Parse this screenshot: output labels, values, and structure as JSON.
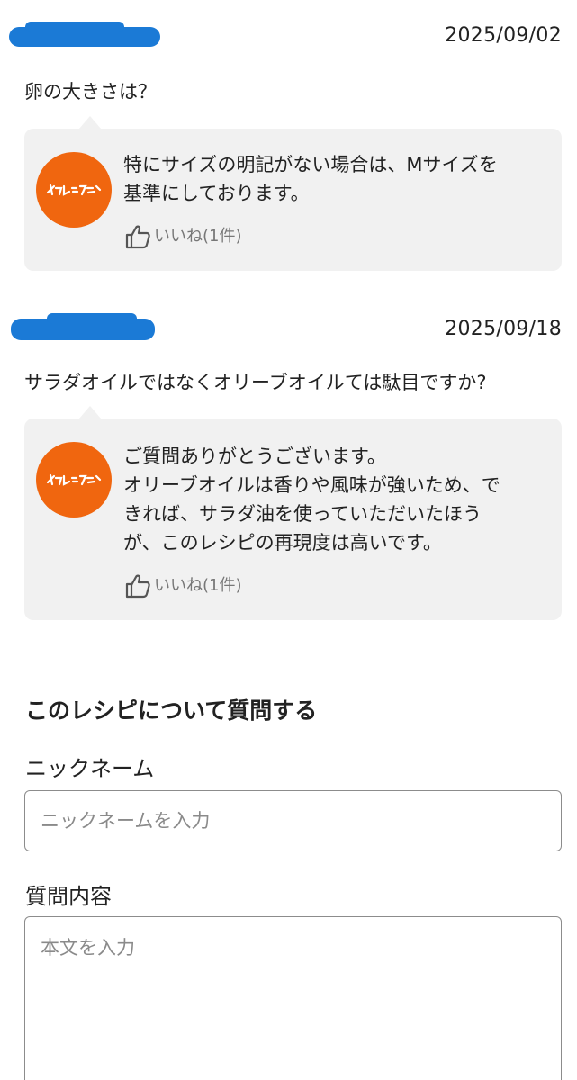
{
  "qa": [
    {
      "date": "2025/09/02",
      "question": "卵の大きさは？",
      "answer": "特にサイズの明記がない場合は、Mサイズを\n基準にしております。",
      "like_label": "いいね(1件)",
      "avatar_icon": "orange-page-logo-icon"
    },
    {
      "date": "2025/09/18",
      "question": "サラダオイルではなくオリーブオイルては駄目ですか?",
      "answer": "ご質問ありがとうございます。\nオリーブオイルは香りや風味が強いため、で\nきれば、サラダ油を使っていただいたほう\nが、このレシピの再現度は高いです。",
      "like_label": "いいね(1件)",
      "avatar_icon": "orange-page-logo-icon"
    }
  ],
  "form": {
    "title": "このレシピについて質問する",
    "nickname_label": "ニックネーム",
    "nickname_placeholder": "ニックネームを入力",
    "content_label": "質問内容",
    "content_placeholder": "本文を入力"
  },
  "colors": {
    "brand_orange": "#f0660f",
    "redaction_blue": "#1b7ad6",
    "answer_background": "#f1f1f1",
    "border": "#8c8c8c"
  }
}
